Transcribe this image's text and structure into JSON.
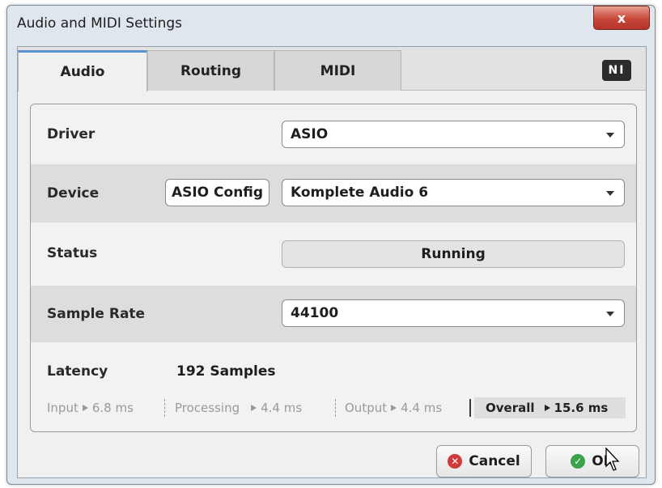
{
  "window": {
    "title": "Audio and MIDI Settings",
    "close_glyph": "x"
  },
  "tabs": [
    {
      "label": "Audio",
      "active": true
    },
    {
      "label": "Routing",
      "active": false
    },
    {
      "label": "MIDI",
      "active": false
    }
  ],
  "logo": {
    "text": "NI",
    "icon": "native-instruments-logo"
  },
  "audio": {
    "driver": {
      "label": "Driver",
      "value": "ASIO"
    },
    "device": {
      "label": "Device",
      "config_button": "ASIO Config",
      "value": "Komplete Audio 6"
    },
    "status": {
      "label": "Status",
      "value": "Running"
    },
    "sample_rate": {
      "label": "Sample Rate",
      "value": "44100"
    },
    "latency": {
      "label": "Latency",
      "value": "192 Samples",
      "input_label": "Input",
      "input_value": "6.8 ms",
      "processing_label": "Processing",
      "processing_value": "4.4 ms",
      "output_label": "Output",
      "output_value": "4.4 ms",
      "overall_label": "Overall",
      "overall_value": "15.6 ms"
    }
  },
  "buttons": {
    "cancel": "Cancel",
    "ok": "OK"
  },
  "colors": {
    "tab_accent": "#5a8fd0",
    "close_red": "#c8473a",
    "cancel_red": "#d03a3a",
    "ok_green": "#3aa24a"
  }
}
